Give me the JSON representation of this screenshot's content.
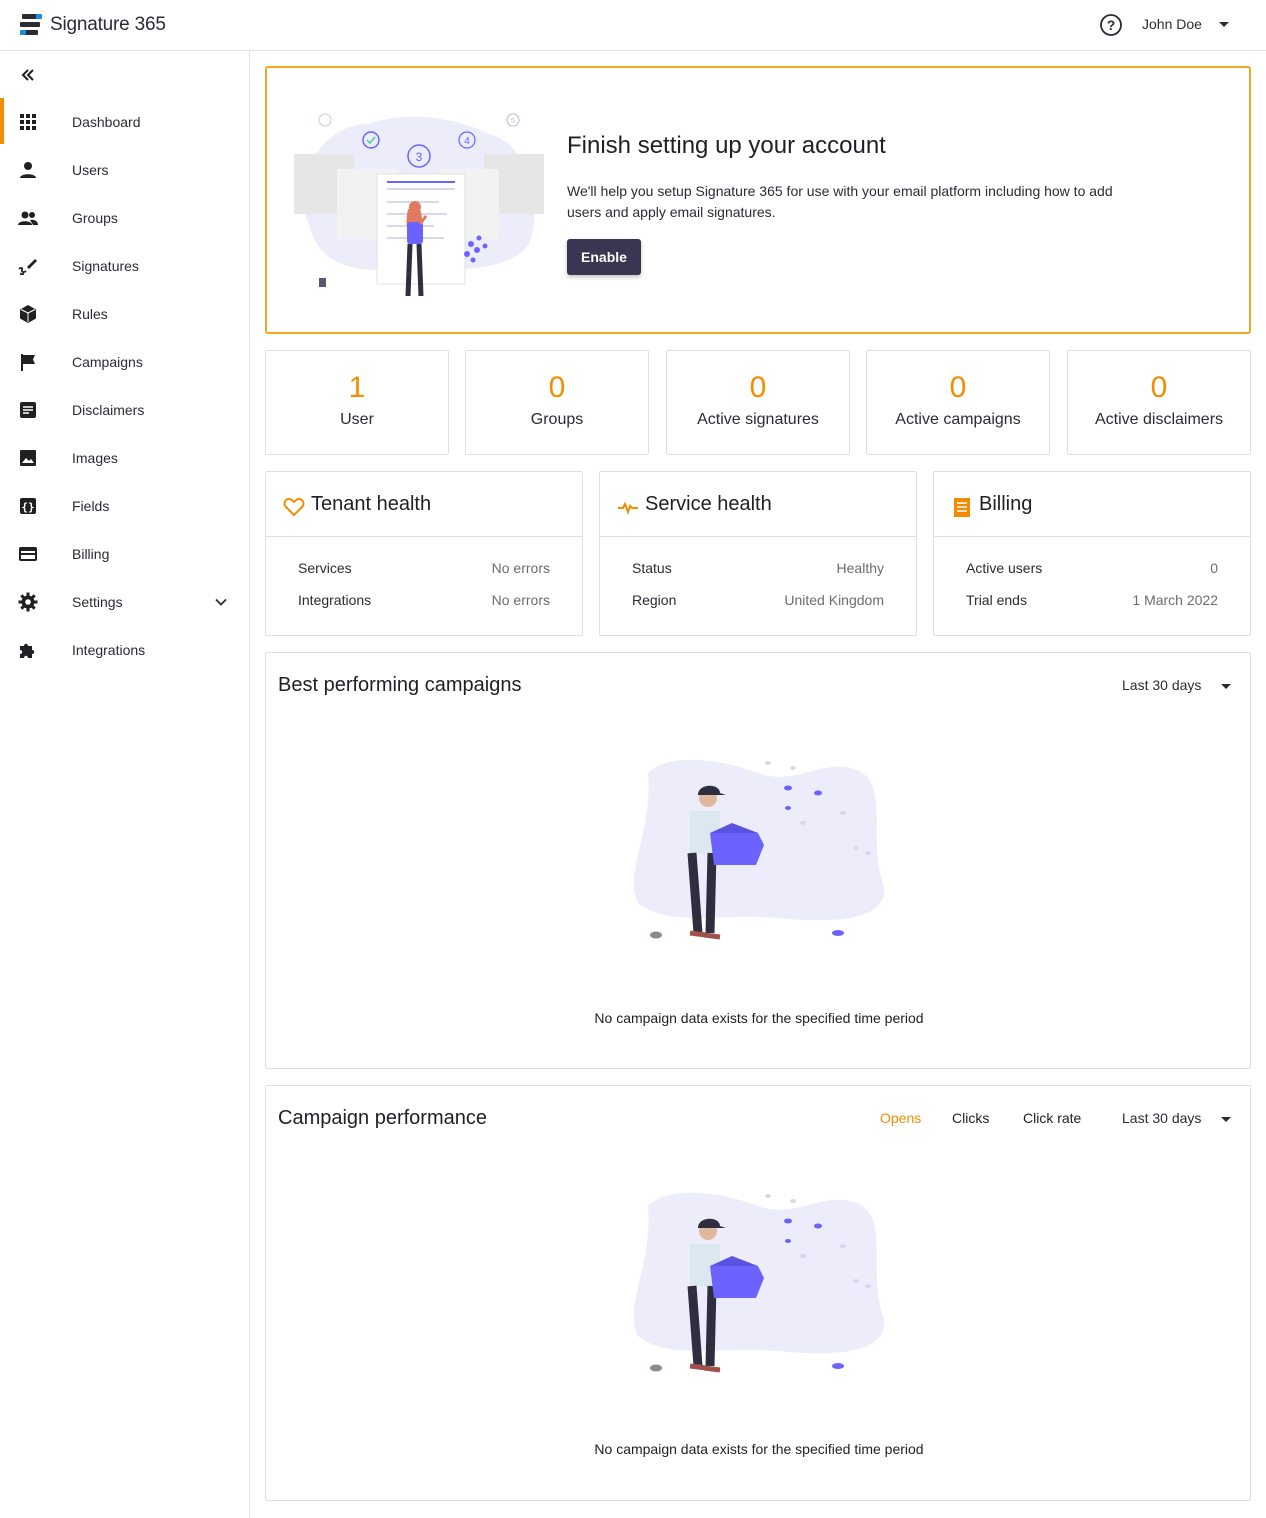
{
  "header": {
    "brand": "Signature 365",
    "user_name": "John Doe"
  },
  "sidebar": {
    "items": [
      {
        "label": "Dashboard",
        "icon": "grid-icon",
        "active": true
      },
      {
        "label": "Users",
        "icon": "user-icon"
      },
      {
        "label": "Groups",
        "icon": "group-icon"
      },
      {
        "label": "Signatures",
        "icon": "signature-icon"
      },
      {
        "label": "Rules",
        "icon": "cube-icon"
      },
      {
        "label": "Campaigns",
        "icon": "flag-icon"
      },
      {
        "label": "Disclaimers",
        "icon": "document-icon"
      },
      {
        "label": "Images",
        "icon": "image-icon"
      },
      {
        "label": "Fields",
        "icon": "braces-icon"
      },
      {
        "label": "Billing",
        "icon": "credit-card-icon"
      },
      {
        "label": "Settings",
        "icon": "gear-icon",
        "expandable": true
      },
      {
        "label": "Integrations",
        "icon": "puzzle-icon"
      }
    ]
  },
  "setup": {
    "title": "Finish setting up your account",
    "description": "We'll help you setup Signature 365 for use with your email platform including how to add users and apply email signatures.",
    "button": "Enable"
  },
  "stats": [
    {
      "value": "1",
      "label": "User"
    },
    {
      "value": "0",
      "label": "Groups"
    },
    {
      "value": "0",
      "label": "Active signatures"
    },
    {
      "value": "0",
      "label": "Active campaigns"
    },
    {
      "value": "0",
      "label": "Active disclaimers"
    }
  ],
  "tenant_health": {
    "title": "Tenant health",
    "rows": [
      {
        "key": "Services",
        "value": "No errors"
      },
      {
        "key": "Integrations",
        "value": "No errors"
      }
    ]
  },
  "service_health": {
    "title": "Service health",
    "rows": [
      {
        "key": "Status",
        "value": "Healthy"
      },
      {
        "key": "Region",
        "value": "United Kingdom"
      }
    ]
  },
  "billing": {
    "title": "Billing",
    "rows": [
      {
        "key": "Active users",
        "value": "0"
      },
      {
        "key": "Trial ends",
        "value": "1 March 2022"
      }
    ]
  },
  "best_campaigns": {
    "title": "Best performing campaigns",
    "range": "Last 30 days",
    "empty_message": "No campaign data exists for the specified time period"
  },
  "campaign_performance": {
    "title": "Campaign performance",
    "metrics": [
      "Opens",
      "Clicks",
      "Click rate"
    ],
    "active_metric": "Opens",
    "range": "Last 30 days",
    "empty_message": "No campaign data exists for the specified time period"
  },
  "colors": {
    "accent": "#f28c00",
    "button": "#3a3652",
    "illustration": "#6c63ff"
  }
}
